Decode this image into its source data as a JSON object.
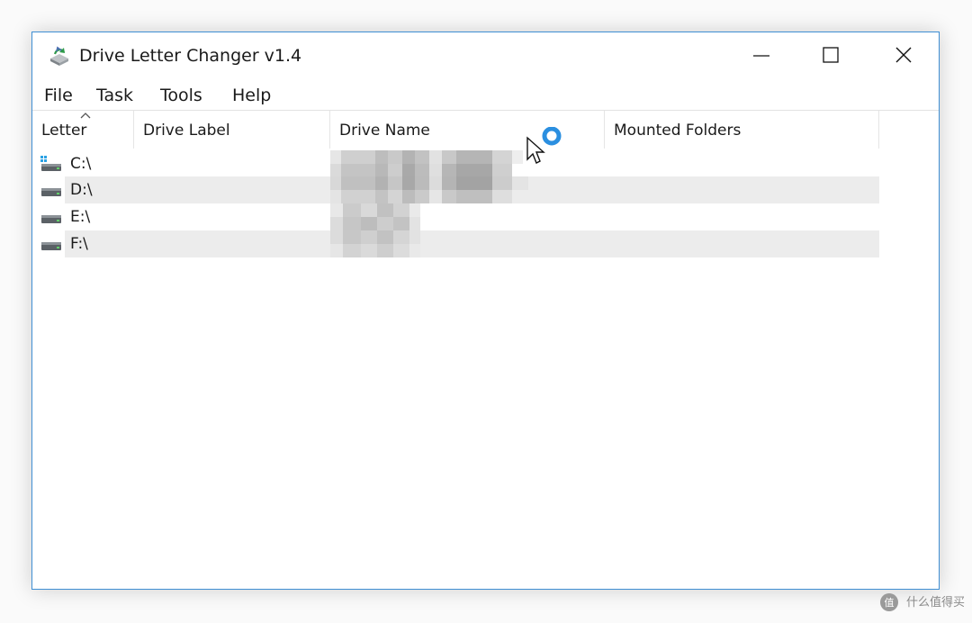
{
  "window": {
    "title": "Drive Letter Changer v1.4",
    "accent_color": "#3f8fd4"
  },
  "menu": {
    "file": "File",
    "task": "Task",
    "tools": "Tools",
    "help": "Help"
  },
  "columns": {
    "letter": "Letter",
    "drive_label": "Drive Label",
    "drive_name": "Drive Name",
    "mounted_folders": "Mounted Folders"
  },
  "sort": {
    "column": "letter",
    "direction": "ascending",
    "icon": "sort-up-arrow-icon"
  },
  "drives": [
    {
      "letter": "C:\\",
      "icon": "windows-system-drive-icon",
      "label": "",
      "name": "",
      "mounted": ""
    },
    {
      "letter": "D:\\",
      "icon": "hard-drive-icon",
      "label": "",
      "name": "",
      "mounted": ""
    },
    {
      "letter": "E:\\",
      "icon": "hard-drive-icon",
      "label": "",
      "name": "",
      "mounted": ""
    },
    {
      "letter": "F:\\",
      "icon": "hard-drive-icon",
      "label": "",
      "name": "",
      "mounted": ""
    }
  ],
  "watermark": {
    "icon": "zhidemai-logo-icon",
    "text": "什么值得买"
  }
}
